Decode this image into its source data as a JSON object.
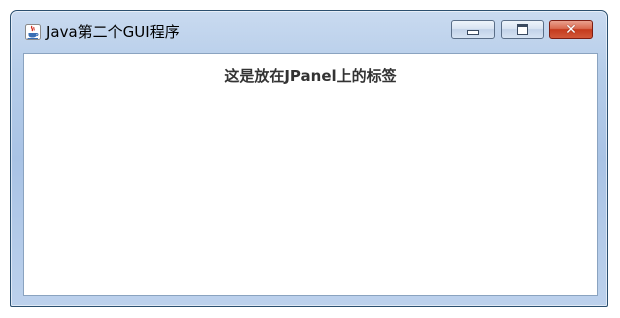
{
  "window": {
    "title": "Java第二个GUI程序",
    "icon": "java-cup-icon",
    "controls": {
      "minimize_icon": "minimize-icon",
      "maximize_icon": "maximize-icon",
      "close_icon": "close-icon",
      "close_glyph": "✕"
    }
  },
  "panel": {
    "label": "这是放在JPanel上的标签"
  },
  "colors": {
    "titlebar": "#b6cde9",
    "close_button": "#c43a1d",
    "panel_background": "#ffffff",
    "label_text": "#333333"
  }
}
